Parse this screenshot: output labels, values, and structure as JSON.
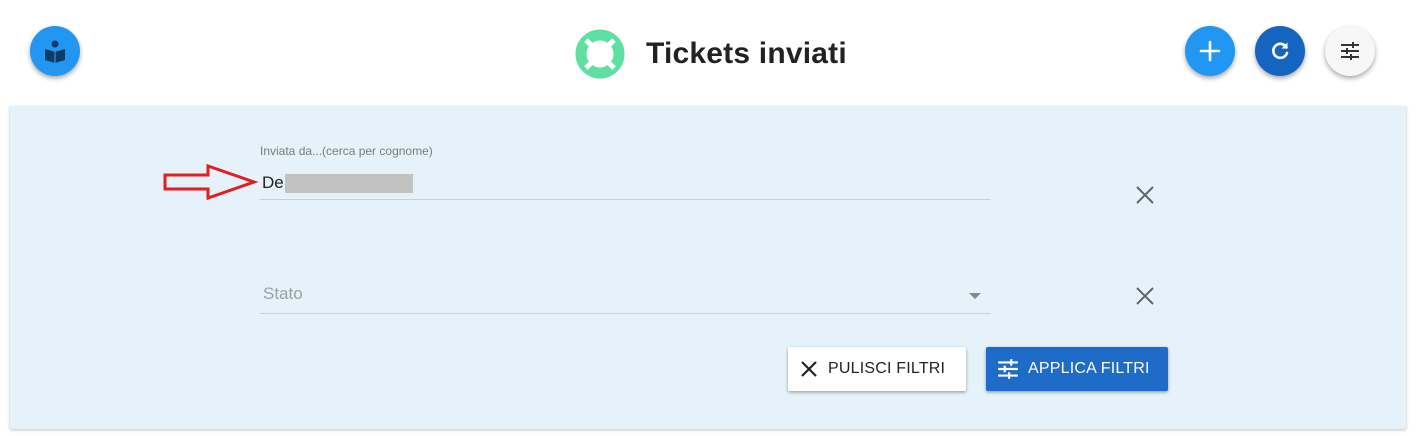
{
  "header": {
    "title": "Tickets inviati",
    "title_icon": "lifebuoy-icon",
    "left_button_icon": "reader-book-icon",
    "actions": [
      {
        "name": "add-button",
        "icon": "plus-icon"
      },
      {
        "name": "refresh-button",
        "icon": "refresh-icon"
      },
      {
        "name": "filter-button",
        "icon": "sliders-icon"
      }
    ]
  },
  "filters": {
    "sender": {
      "label": "Inviata da...(cerca per cognome)",
      "value": "De"
    },
    "status": {
      "placeholder": "Stato",
      "value": ""
    },
    "clear_label": "PULISCI FILTRI",
    "apply_label": "APPLICA FILTRI"
  },
  "colors": {
    "primary": "#2196f3",
    "primary_dark": "#1565c0",
    "apply": "#1e6cc8",
    "panel_bg": "#e5f2fa",
    "title_icon": "#5ee0a3",
    "annotation": "#e02020"
  }
}
